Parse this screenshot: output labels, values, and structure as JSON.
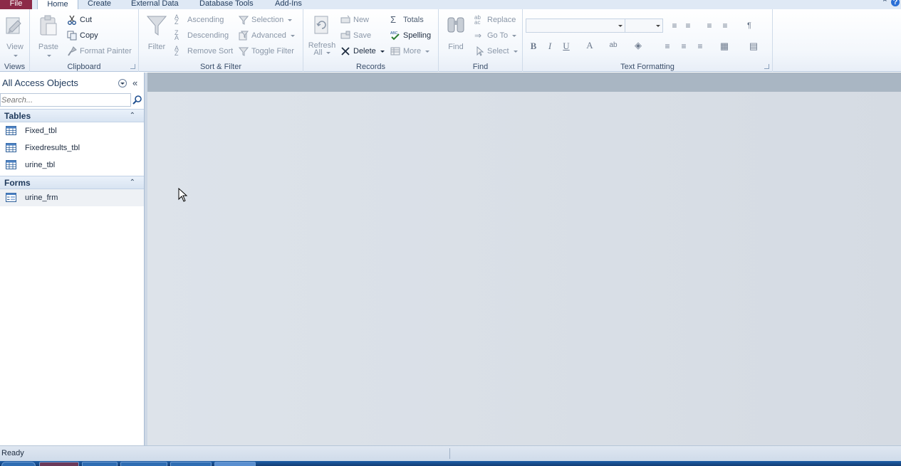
{
  "ribbon_tabs": {
    "file": "File",
    "home": "Home",
    "create": "Create",
    "external": "External Data",
    "dbtools": "Database Tools",
    "addins": "Add-Ins"
  },
  "groups": {
    "views": {
      "label": "Views",
      "view": "View"
    },
    "clipboard": {
      "label": "Clipboard",
      "paste": "Paste",
      "cut": "Cut",
      "copy": "Copy",
      "format_painter": "Format Painter"
    },
    "sort_filter": {
      "label": "Sort & Filter",
      "filter": "Filter",
      "ascending": "Ascending",
      "descending": "Descending",
      "remove_sort": "Remove Sort",
      "selection": "Selection",
      "advanced": "Advanced",
      "toggle_filter": "Toggle Filter"
    },
    "records": {
      "label": "Records",
      "refresh_line1": "Refresh",
      "refresh_line2": "All",
      "new": "New",
      "save": "Save",
      "delete": "Delete",
      "totals": "Totals",
      "spelling": "Spelling",
      "more": "More"
    },
    "find": {
      "label": "Find",
      "find": "Find",
      "replace": "Replace",
      "goto": "Go To",
      "select": "Select"
    },
    "text_formatting": {
      "label": "Text Formatting",
      "bold": "B",
      "italic": "I",
      "underline": "U",
      "font_color": "A"
    }
  },
  "nav": {
    "title": "All Access Objects",
    "search_placeholder": "Search...",
    "tables_label": "Tables",
    "forms_label": "Forms",
    "tables": [
      {
        "name": "Fixed_tbl"
      },
      {
        "name": "Fixedresults_tbl"
      },
      {
        "name": "urine_tbl"
      }
    ],
    "forms": [
      {
        "name": "urine_frm"
      }
    ]
  },
  "status": {
    "text": "Ready"
  },
  "colors": {
    "file_tab": "#8c2a48",
    "workspace": "#dde3ea",
    "workspace_bar": "#a9b6c3"
  }
}
